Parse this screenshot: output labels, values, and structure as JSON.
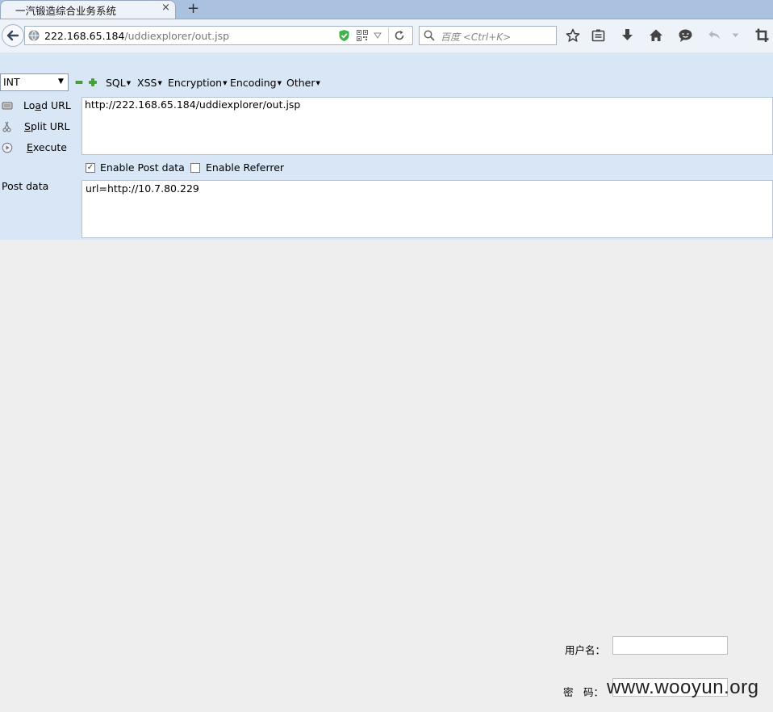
{
  "tab": {
    "title": "一汽锻造综合业务系统",
    "close": "×",
    "new_tab": "+"
  },
  "address": {
    "host": "222.168.65.184",
    "path": "/uddiexplorer/out.jsp"
  },
  "search": {
    "placeholder": "百度 <Ctrl+K>"
  },
  "toolbar_icons": [
    "star-icon",
    "reading-list-icon",
    "download-icon",
    "home-icon",
    "chat-icon",
    "undo-icon",
    "dropdown-icon",
    "crop-icon"
  ],
  "hackbar": {
    "select_value": "INT",
    "minus": "−",
    "plus": "+",
    "menus": [
      "SQL",
      "XSS",
      "Encryption",
      "Encoding",
      "Other"
    ],
    "load_url": {
      "pre": "Lo",
      "accel": "a",
      "post": "d URL"
    },
    "split_url": {
      "pre": "",
      "accel": "S",
      "post": "plit URL"
    },
    "execute": {
      "pre": "",
      "accel": "E",
      "post": "xecute"
    },
    "url_value": "http://222.168.65.184/uddiexplorer/out.jsp",
    "enable_post": {
      "label": "Enable Post data",
      "checked": true,
      "mark": "✓"
    },
    "enable_referrer": {
      "label": "Enable Referrer",
      "checked": false
    },
    "post_label": "Post data",
    "post_value": "url=http://10.7.80.229"
  },
  "page": {
    "username_label": "用户名：",
    "password_label": "密　码：",
    "watermark": "www.wooyun.org"
  }
}
